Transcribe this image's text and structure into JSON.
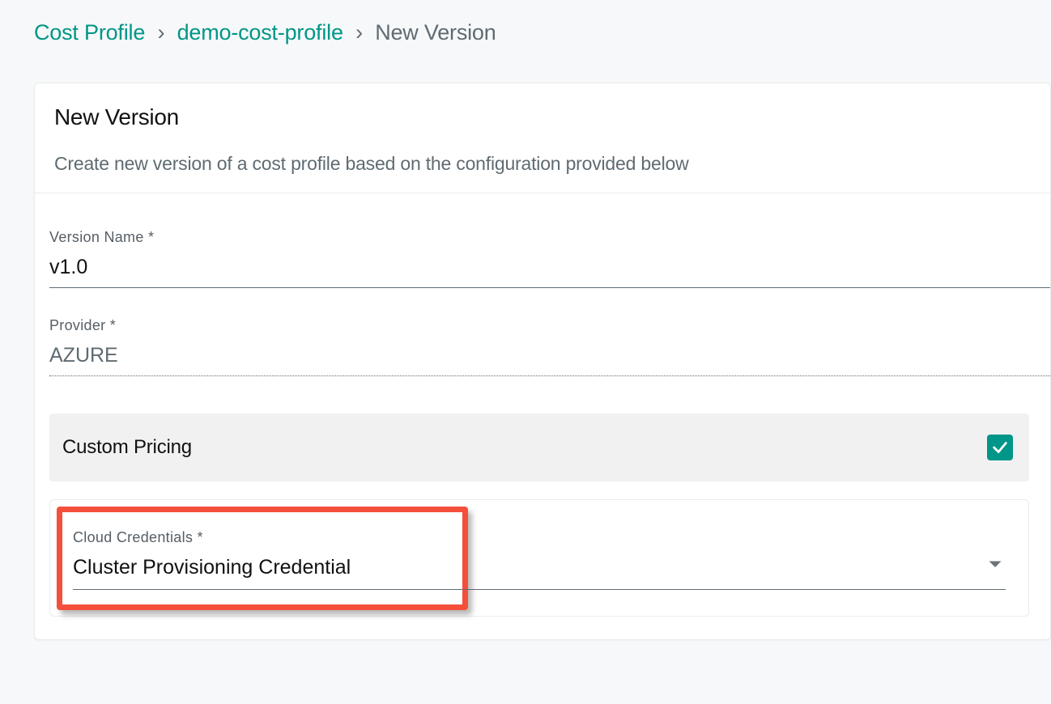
{
  "breadcrumb": {
    "root": "Cost Profile",
    "parent": "demo-cost-profile",
    "current": "New Version",
    "sep": "›"
  },
  "header": {
    "title": "New Version",
    "subtitle": "Create new version of a cost profile based on the configuration provided below"
  },
  "form": {
    "version_name": {
      "label": "Version Name *",
      "value": "v1.0"
    },
    "provider": {
      "label": "Provider *",
      "value": "AZURE"
    },
    "custom_pricing": {
      "label": "Custom Pricing",
      "checked": true
    },
    "cloud_credentials": {
      "label": "Cloud Credentials *",
      "selected": "Cluster Provisioning Credential"
    }
  }
}
